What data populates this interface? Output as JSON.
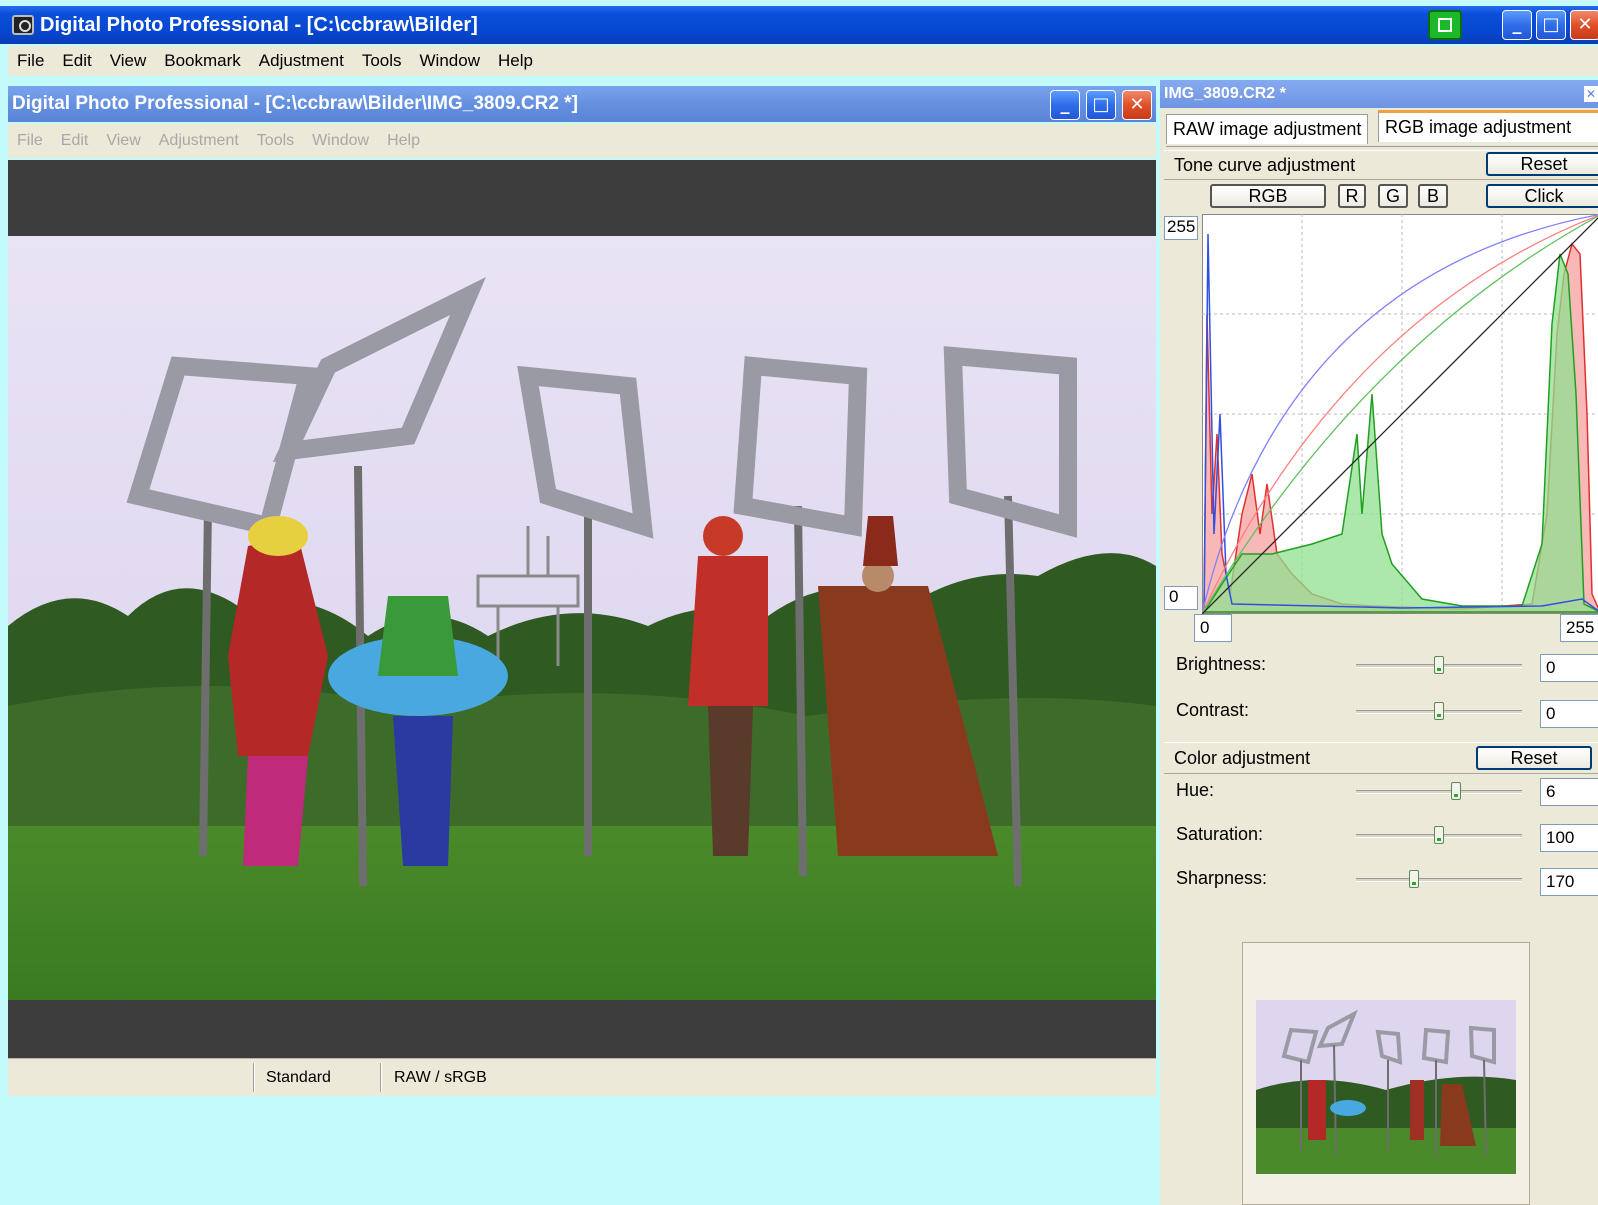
{
  "main_window": {
    "title": "Digital Photo Professional - [C:\\ccbraw\\Bilder]",
    "menu": [
      "File",
      "Edit",
      "View",
      "Bookmark",
      "Adjustment",
      "Tools",
      "Window",
      "Help"
    ]
  },
  "viewer_window": {
    "title": "Digital Photo Professional - [C:\\ccbraw\\Bilder\\IMG_3809.CR2 *]",
    "menu": [
      "File",
      "Edit",
      "View",
      "Adjustment",
      "Tools",
      "Window",
      "Help"
    ],
    "status": {
      "picture_style": "Standard",
      "color_space": "RAW / sRGB"
    }
  },
  "tool_palette": {
    "title": "IMG_3809.CR2 *",
    "tabs": [
      "RAW image adjustment",
      "RGB image adjustment"
    ],
    "tone_curve": {
      "header": "Tone curve adjustment",
      "reset_label": "Reset",
      "channel_buttons": [
        "RGB",
        "R",
        "G",
        "B"
      ],
      "click_label": "Click",
      "y_max": "255",
      "y_min": "0",
      "input_min": "0",
      "input_max": "255"
    },
    "brightness": {
      "label": "Brightness:",
      "value": "0",
      "level": 0.5
    },
    "contrast": {
      "label": "Contrast:",
      "value": "0",
      "level": 0.5
    },
    "color": {
      "header": "Color adjustment",
      "reset_label": "Reset",
      "hue": {
        "label": "Hue:",
        "value": "6",
        "level": 0.6
      },
      "saturation": {
        "label": "Saturation:",
        "value": "100",
        "level": 0.5
      },
      "sharpness": {
        "label": "Sharpness:",
        "value": "170",
        "level": 0.35
      }
    }
  },
  "colors": {
    "desktop": "#c3fbfd",
    "xp_blue": "#0a4fd9",
    "panel_bg": "#ece9d8"
  }
}
